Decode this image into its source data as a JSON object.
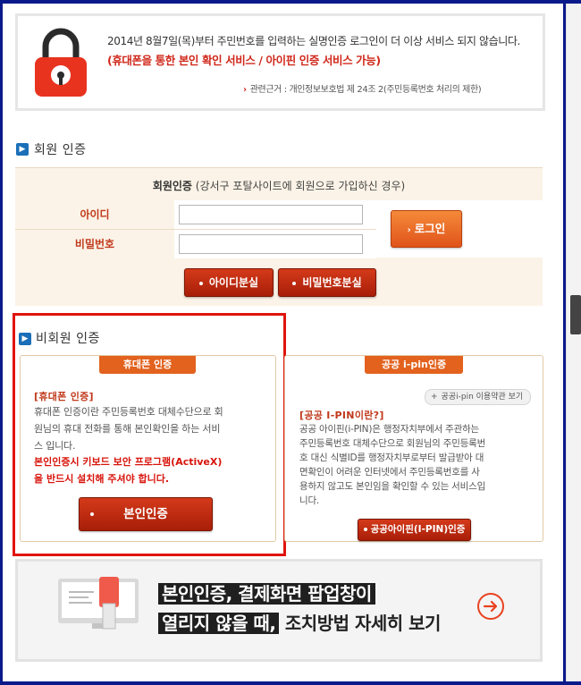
{
  "notice": {
    "line1": "2014년 8월7일(목)부터 주민번호를 입력하는 실명인증 로그인이 더 이상 서비스 되지 않습니다.",
    "line2": "(휴대폰을 통한 본인 확인 서비스 / 아이핀 인증 서비스 가능)",
    "law": "관련근거 : 개인정보보호법 제 24조 2(주민등록번호 처리의 제한)"
  },
  "member": {
    "section_title": "회원 인증",
    "head_bold": "회원인증",
    "head_rest": " (강서구 포탈사이트에 회원으로 가입하신 경우)",
    "id_label": "아이디",
    "pw_label": "비밀번호",
    "login_button": "로그인",
    "find_id_button": "아이디분실",
    "find_pw_button": "비밀번호분실"
  },
  "guest": {
    "section_title": "비회원 인증",
    "phone": {
      "tab": "휴대폰 인증",
      "heading": "[휴대폰 인증]",
      "text": [
        "휴대폰 인증이란 주민등록번호 대체수단으로 회",
        "원님의 휴대 전화를 통해 본인확인을 하는 서비",
        "스 입니다."
      ],
      "warning": [
        "본인인증시 키보드 보안 프로그램(ActiveX)",
        "을 반드시 설치해 주셔야 합니다."
      ],
      "button": "본인인증"
    },
    "ipin": {
      "tab": "공공 i-pin인증",
      "terms_pill": "공공i-pin 이용약관 보기",
      "heading": "[공공 I-PIN이란?]",
      "text": [
        "공공 아이핀(i-PIN)은 행정자치부에서 주관하는",
        "주민등록번호 대체수단으로 회원님의 주민등록번",
        "호 대신 식별ID를 행정자치부로부터 발급받아 대",
        "면확인이 어려운 인터넷에서 주민등록번호를 사",
        "용하지 않고도 본인임을 확인할 수 있는 서비스입",
        "니다."
      ],
      "button": "공공아이핀(I-PIN)인증"
    }
  },
  "banner": {
    "line1": "본인인증, 결제화면 팝업창이",
    "line2_dark": "열리지 않을 때,",
    "line2_plain": "조치방법 자세히 보기"
  },
  "colors": {
    "accent_orange": "#e2621e",
    "warning_red": "#d8140b",
    "frame_blue": "#0a1a8a"
  }
}
